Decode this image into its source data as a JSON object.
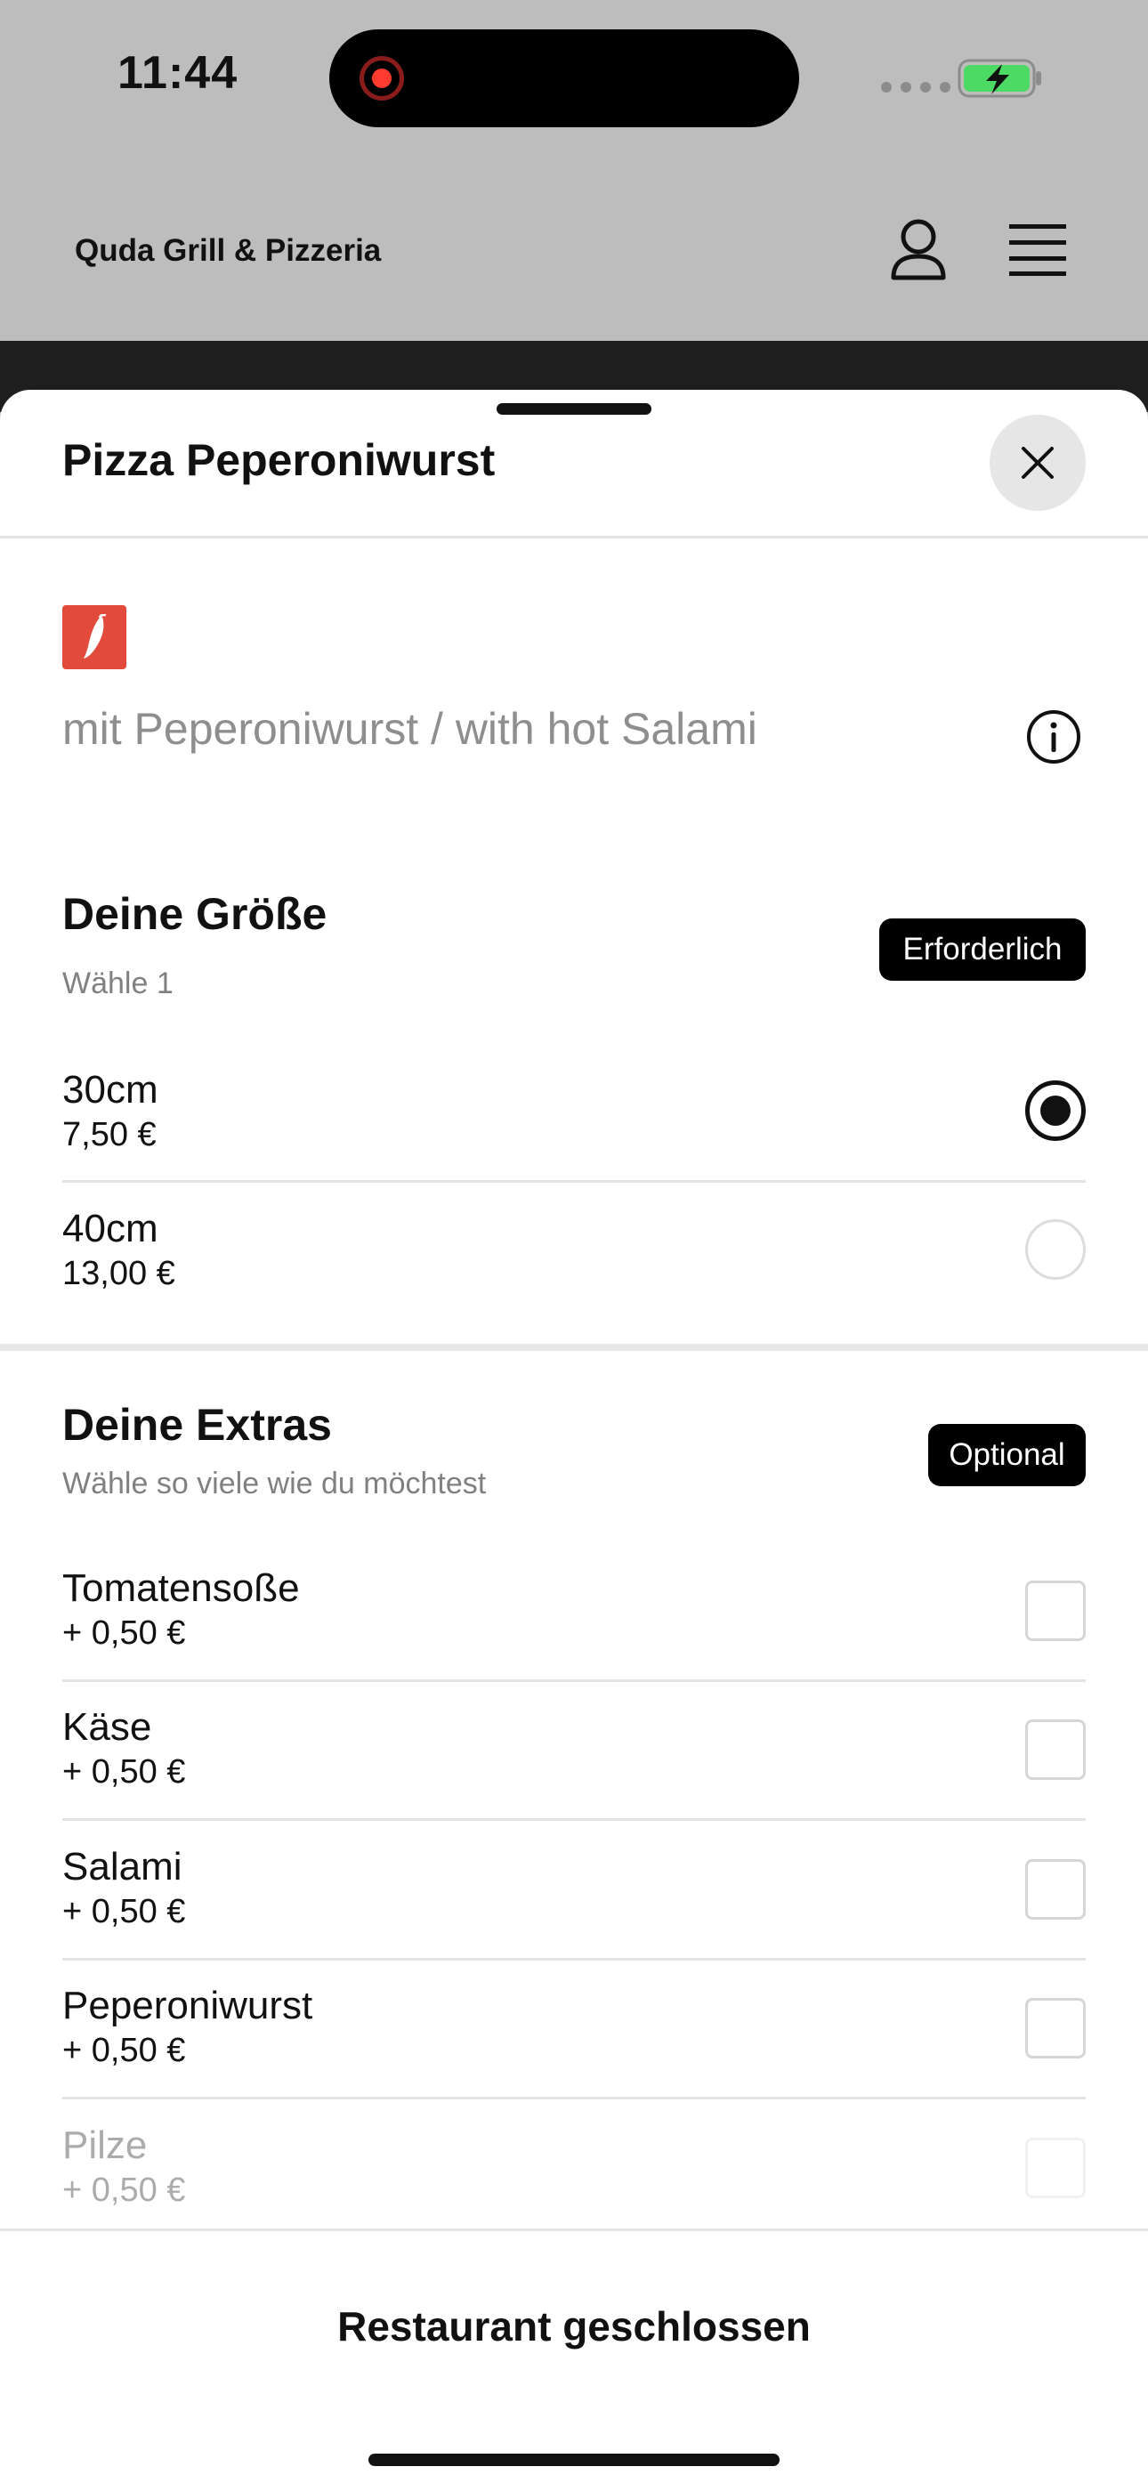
{
  "status_bar": {
    "time": "11:44"
  },
  "header": {
    "restaurant_name": "Quda Grill & Pizzeria",
    "profile_icon": "person-icon",
    "menu_icon": "hamburger-icon"
  },
  "sheet": {
    "title": "Pizza Peperoniwurst",
    "close_icon": "close-icon",
    "spicy_icon": "chili-icon",
    "description": "mit Peperoniwurst / with hot Salami",
    "info_icon": "info-icon"
  },
  "size_section": {
    "title": "Deine Größe",
    "subtitle": "Wähle 1",
    "badge": "Erforderlich",
    "options": [
      {
        "name": "30cm",
        "price": "7,50 €",
        "selected": true
      },
      {
        "name": "40cm",
        "price": "13,00 €",
        "selected": false
      }
    ]
  },
  "extras_section": {
    "title": "Deine Extras",
    "subtitle": "Wähle so viele wie du möchtest",
    "badge": "Optional",
    "options": [
      {
        "name": "Tomatensoße",
        "price": "+ 0,50 €"
      },
      {
        "name": "Käse",
        "price": "+ 0,50 €"
      },
      {
        "name": "Salami",
        "price": "+ 0,50 €"
      },
      {
        "name": "Peperoniwurst",
        "price": "+ 0,50 €"
      },
      {
        "name": "Pilze",
        "price": "+ 0,50 €"
      }
    ]
  },
  "footer": {
    "status": "Restaurant geschlossen"
  },
  "colors": {
    "accent": "#000000",
    "spicy": "#e24a3b",
    "overlay": "#bdbdbd"
  }
}
